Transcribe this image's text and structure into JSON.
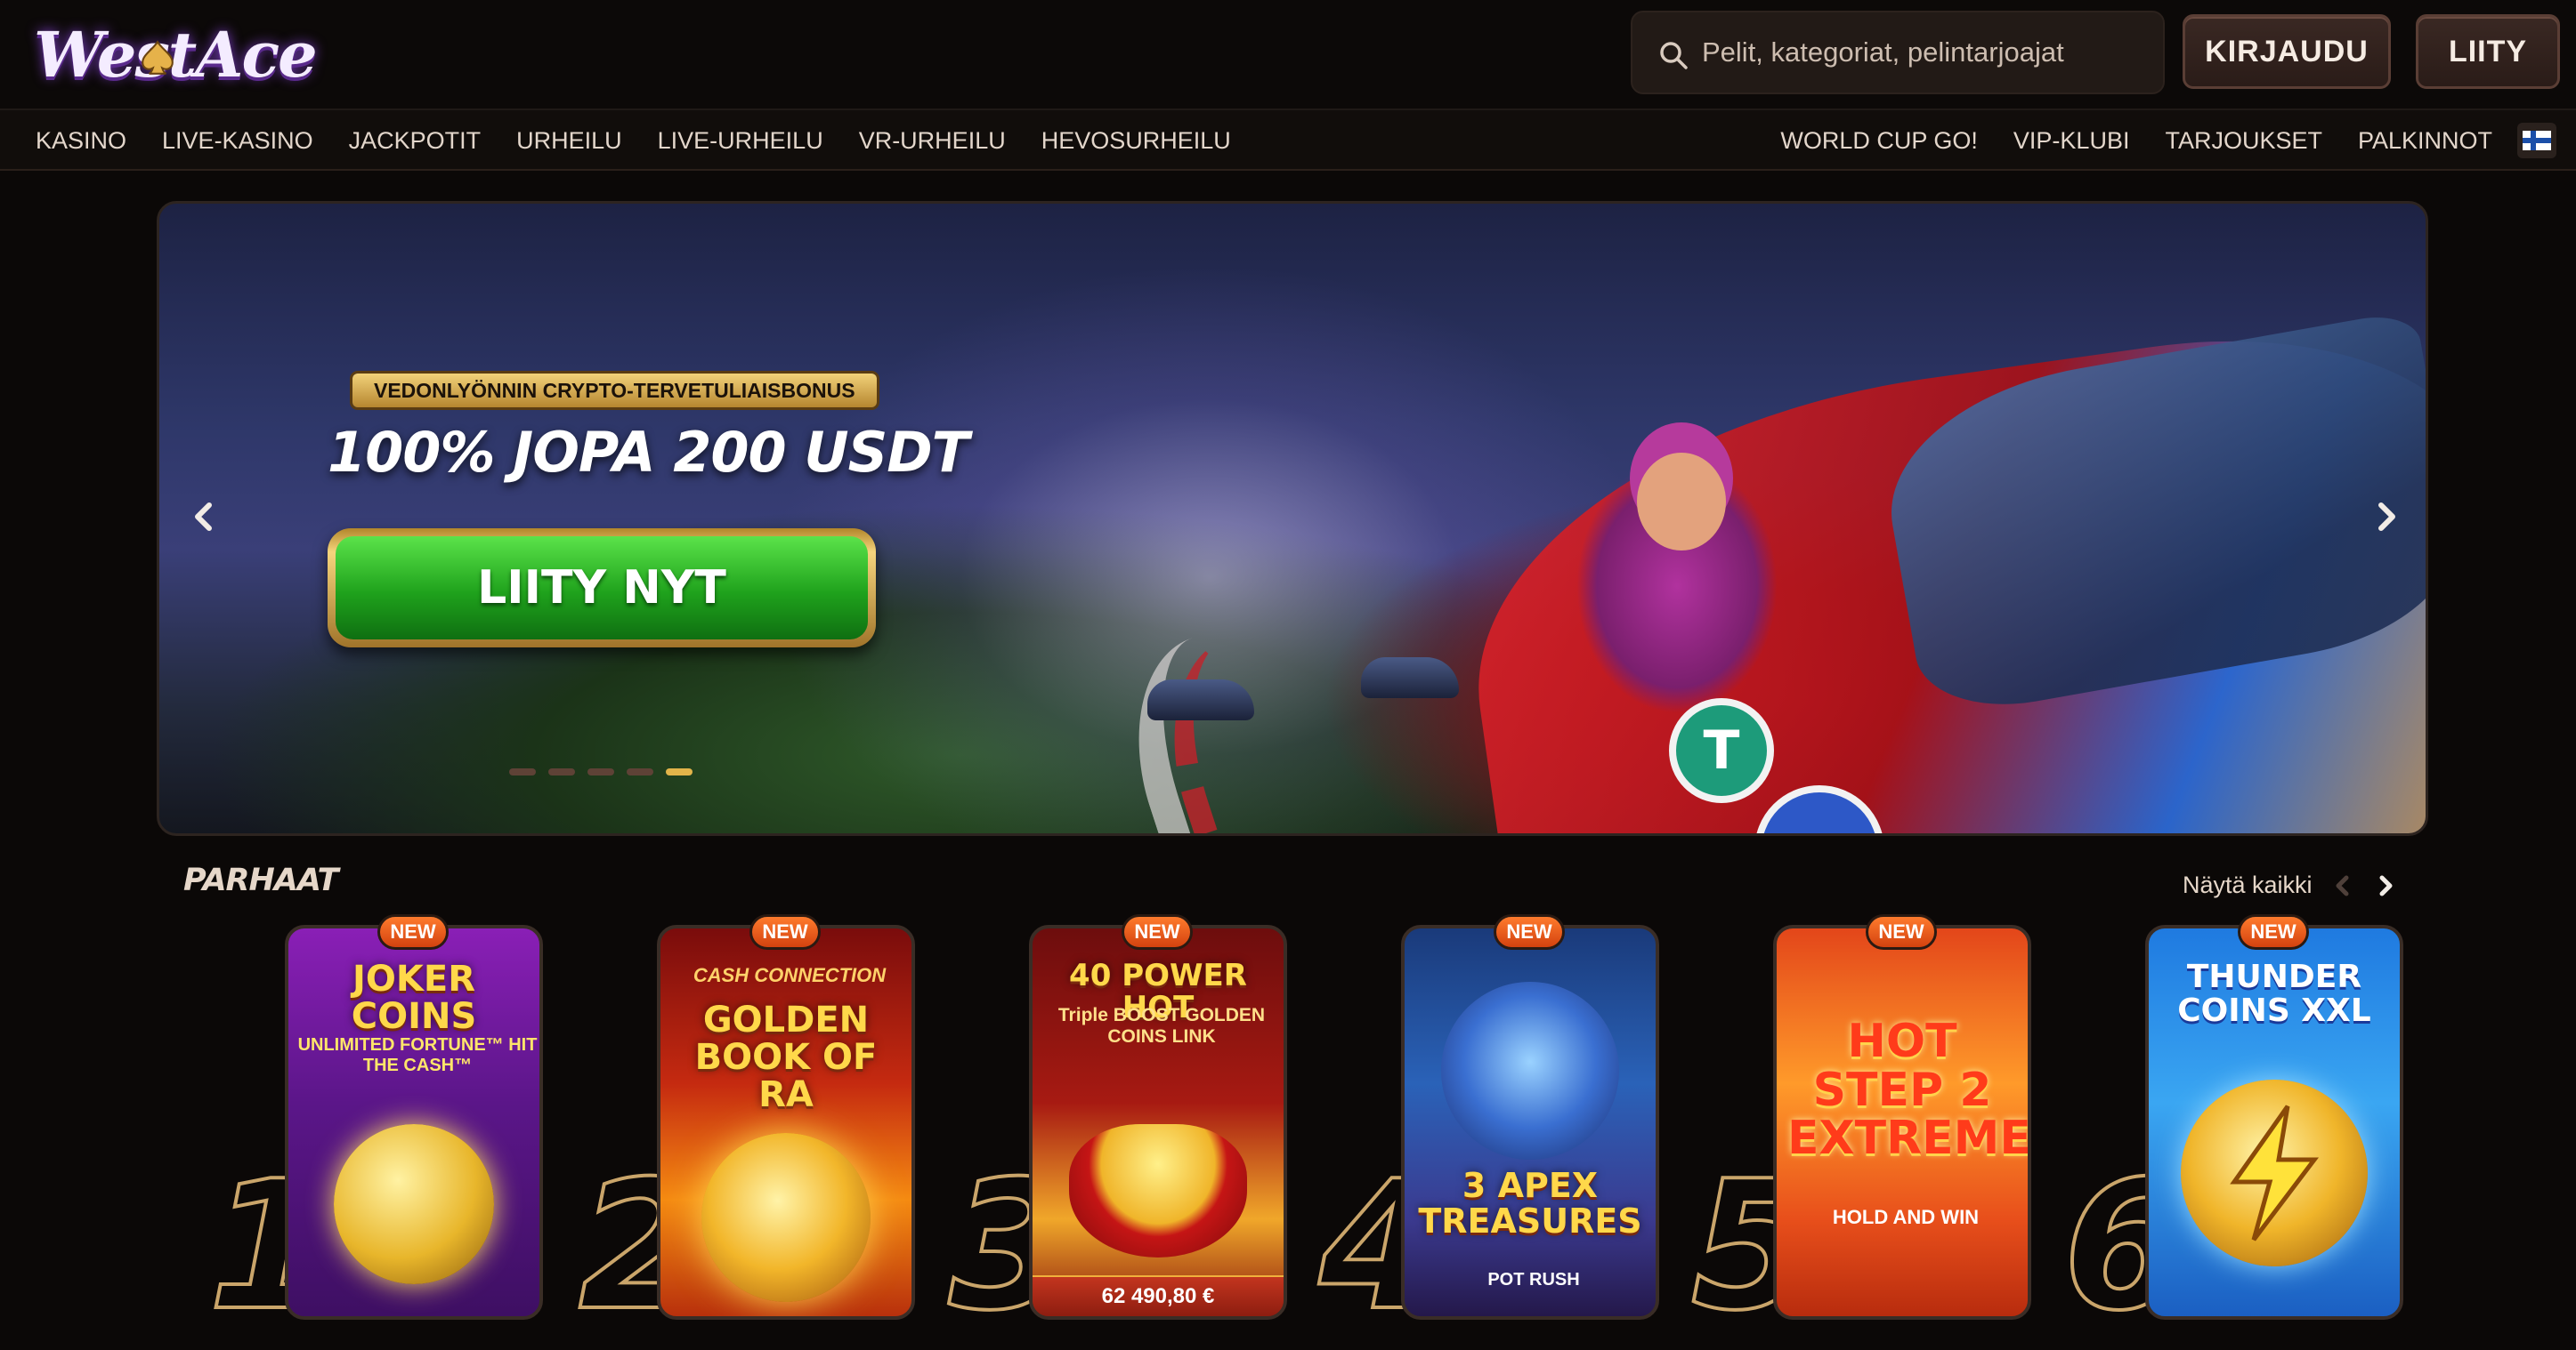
{
  "brand": {
    "logo_text": "WestAce"
  },
  "header": {
    "search_placeholder": "Pelit, kategoriat, pelintarjoajat",
    "login_label": "KIRJAUDU",
    "join_label": "LIITY"
  },
  "nav": {
    "left": [
      "KASINO",
      "LIVE-KASINO",
      "JACKPOTIT",
      "URHEILU",
      "LIVE-URHEILU",
      "VR-URHEILU",
      "HEVOSURHEILU"
    ],
    "right": [
      "WORLD CUP GO!",
      "VIP-KLUBI",
      "TARJOUKSET",
      "PALKINNOT"
    ],
    "language_flag": "finland-flag-icon"
  },
  "banner": {
    "ribbon": "VEDONLYÖNNIN CRYPTO-TERVETULIAISBONUS",
    "title": "100% JOPA 200 USDT",
    "cta": "LIITY NYT",
    "slide_count": 5,
    "active_slide": 5,
    "coins": [
      "T",
      "◆",
      "₿"
    ]
  },
  "best": {
    "title": "PARHAAT",
    "show_all": "Näytä kaikki",
    "badge": "NEW",
    "games": [
      {
        "rank": "1",
        "title": "JOKER COINS",
        "subtitle": "UNLIMITED FORTUNE™ HIT THE CASH™"
      },
      {
        "rank": "2",
        "title": "GOLDEN BOOK OF RA",
        "subtitle": "CASH CONNECTION"
      },
      {
        "rank": "3",
        "title": "40 POWER HOT",
        "subtitle": "Triple BOOST GOLDEN COINS LINK",
        "jackpot": "62 490,80 €"
      },
      {
        "rank": "4",
        "title": "3 APEX TREASURES",
        "subtitle": "POT RUSH"
      },
      {
        "rank": "5",
        "title": "HOT STEP 2 EXTREME",
        "subtitle": "HOLD AND WIN"
      },
      {
        "rank": "6",
        "title": "THUNDER COINS XXL",
        "subtitle": ""
      }
    ]
  },
  "colors": {
    "background": "#0b0807",
    "accent_gold": "#e2b44a",
    "cta_green": "#1fa21c",
    "badge_orange": "#ff7b2d"
  }
}
